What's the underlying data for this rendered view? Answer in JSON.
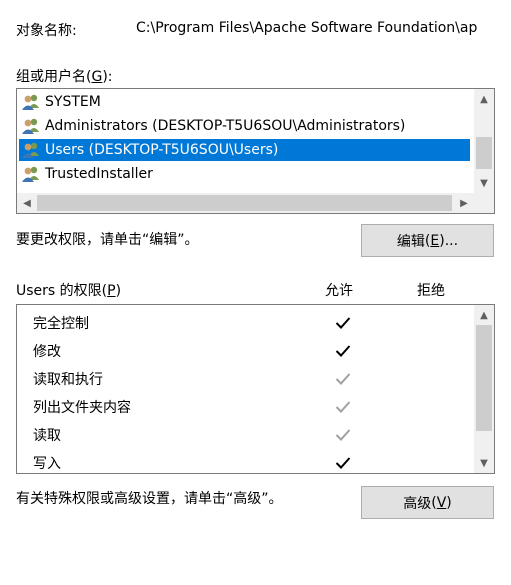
{
  "object": {
    "label": "对象名称:",
    "value": "C:\\Program Files\\Apache Software Foundation\\ap"
  },
  "group_section": {
    "label": "组或用户名",
    "hotkey": "G",
    "users": [
      {
        "name": "SYSTEM",
        "selected": false
      },
      {
        "name": "Administrators (DESKTOP-T5U6SOU\\Administrators)",
        "selected": false
      },
      {
        "name": "Users (DESKTOP-T5U6SOU\\Users)",
        "selected": true
      },
      {
        "name": "TrustedInstaller",
        "selected": false
      }
    ]
  },
  "edit_hint": "要更改权限，请单击“编辑”。",
  "edit_button": {
    "label": "编辑",
    "hotkey": "E",
    "suffix": "..."
  },
  "permissions": {
    "label": "Users 的权限",
    "hotkey": "P",
    "allow_header": "允许",
    "deny_header": "拒绝",
    "rows": [
      {
        "name": "完全控制",
        "allow": "explicit",
        "deny": "none"
      },
      {
        "name": "修改",
        "allow": "explicit",
        "deny": "none"
      },
      {
        "name": "读取和执行",
        "allow": "inherited",
        "deny": "none"
      },
      {
        "name": "列出文件夹内容",
        "allow": "inherited",
        "deny": "none"
      },
      {
        "name": "读取",
        "allow": "inherited",
        "deny": "none"
      },
      {
        "name": "写入",
        "allow": "explicit",
        "deny": "none"
      }
    ]
  },
  "advanced_hint": "有关特殊权限或高级设置，请单击“高级”。",
  "advanced_button": {
    "label": "高级",
    "hotkey": "V"
  },
  "colors": {
    "selection": "#0078d7",
    "check_explicit": "#000000",
    "check_inherited": "#a0a0a0",
    "button_bg": "#e1e1e1"
  }
}
